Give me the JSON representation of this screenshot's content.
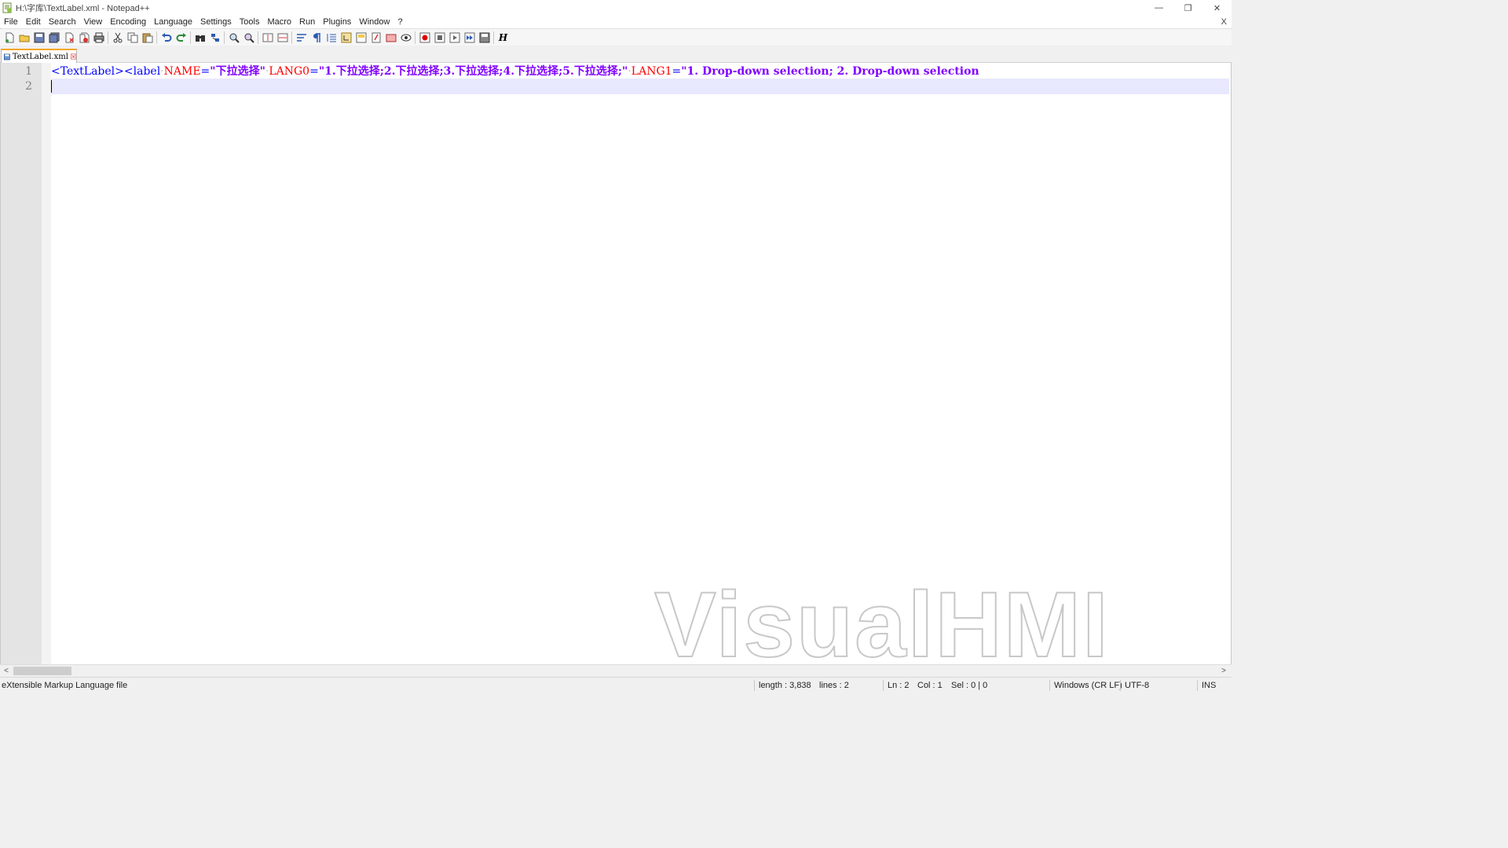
{
  "window": {
    "title": "H:\\字库\\TextLabel.xml - Notepad++",
    "minimize_glyph": "—",
    "restore_glyph": "❐",
    "close_glyph": "✕"
  },
  "menu": {
    "items": [
      "File",
      "Edit",
      "Search",
      "View",
      "Encoding",
      "Language",
      "Settings",
      "Tools",
      "Macro",
      "Run",
      "Plugins",
      "Window",
      "?"
    ],
    "close_glyph": "X"
  },
  "toolbar": {
    "buttons": [
      "new-file-icon",
      "open-file-icon",
      "save-icon",
      "save-all-icon",
      "close-icon",
      "close-all-icon",
      "print-icon",
      "cut-icon",
      "copy-icon",
      "paste-icon",
      "undo-icon",
      "redo-icon",
      "find-icon",
      "replace-icon",
      "zoom-in-icon",
      "zoom-out-icon",
      "sync-vertical-icon",
      "sync-horizontal-icon",
      "word-wrap-icon",
      "show-all-chars-icon",
      "indent-guide-icon",
      "udl-icon",
      "doc-map-icon",
      "function-list-icon",
      "folder-workspace-icon",
      "monitoring-icon",
      "record-macro-icon",
      "stop-macro-icon",
      "play-macro-icon",
      "run-macro-multiple-icon",
      "save-macro-icon",
      "html-tag-icon"
    ],
    "html_tag_glyph": "H"
  },
  "tab": {
    "label": "TextLabel.xml",
    "close_glyph": "×"
  },
  "editor": {
    "line_numbers": [
      "1",
      "2"
    ],
    "line1": {
      "tag_open": "<TextLabel><label",
      "attr_name": "NAME",
      "val_name": "\"下拉选择\"",
      "attr_lang0": "LANG0",
      "val_lang0": "\"1.下拉选择;2.下拉选择;3.下拉选择;4.下拉选择;5.下拉选择;\"",
      "attr_lang1": "LANG1",
      "val_lang1": "\"1. Drop-down selection; 2. Drop-down selection",
      "eq": "=",
      "ws": "·"
    },
    "watermark": "VisualHMI"
  },
  "scrollbar": {
    "left_glyph": "<",
    "right_glyph": ">"
  },
  "status": {
    "file_type": "eXtensible Markup Language file",
    "length": "length : 3,838",
    "lines": "lines : 2",
    "ln": "Ln : 2",
    "col": "Col : 1",
    "sel": "Sel : 0 | 0",
    "eol": "Windows (CR LF)",
    "encoding": "UTF-8",
    "mode": "INS"
  }
}
